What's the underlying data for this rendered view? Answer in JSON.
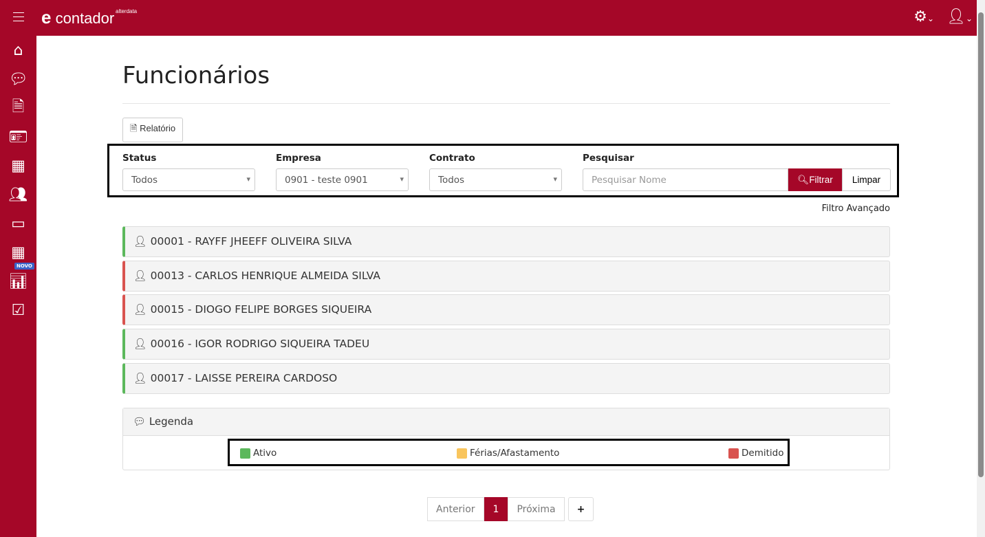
{
  "header": {
    "brand": "contador",
    "brand_small": "alterdata",
    "brand_letter": "e"
  },
  "sidebar": {
    "badge": "NOVO"
  },
  "page": {
    "title": "Funcionários",
    "report_button": "Relatório"
  },
  "filters": {
    "status": {
      "label": "Status",
      "value": "Todos"
    },
    "empresa": {
      "label": "Empresa",
      "value": "0901 - teste 0901"
    },
    "contrato": {
      "label": "Contrato",
      "value": "Todos"
    },
    "pesquisar": {
      "label": "Pesquisar",
      "placeholder": "Pesquisar Nome"
    },
    "filter_button": "Filtrar",
    "clear_button": "Limpar",
    "advanced": "Filtro Avançado"
  },
  "employees": [
    {
      "name": "00001 - RAYFF JHEEFF OLIVEIRA SILVA",
      "status": "Ativo",
      "color": "#5cb85c"
    },
    {
      "name": "00013 - CARLOS HENRIQUE ALMEIDA SILVA",
      "status": "Demitido",
      "color": "#d9534f"
    },
    {
      "name": "00015 - DIOGO FELIPE BORGES SIQUEIRA",
      "status": "Demitido",
      "color": "#d9534f"
    },
    {
      "name": "00016 - IGOR RODRIGO SIQUEIRA TADEU",
      "status": "Ativo",
      "color": "#5cb85c"
    },
    {
      "name": "00017 - LAISSE PEREIRA CARDOSO",
      "status": "Ativo",
      "color": "#5cb85c"
    }
  ],
  "legend": {
    "title": "Legenda",
    "items": [
      {
        "label": "Ativo",
        "color": "#5cb85c"
      },
      {
        "label": "Férias/Afastamento",
        "color": "#f9c55d"
      },
      {
        "label": "Demitido",
        "color": "#d9534f"
      }
    ]
  },
  "pagination": {
    "prev": "Anterior",
    "current": "1",
    "next": "Próxima",
    "add": "+"
  },
  "colors": {
    "brand": "#a50728"
  }
}
